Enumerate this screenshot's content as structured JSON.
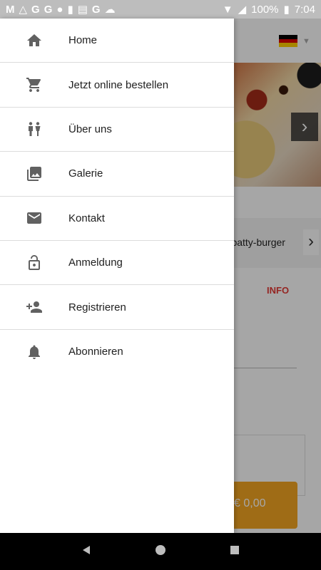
{
  "status_bar": {
    "left_icons": [
      "gmail-icon",
      "triangle-drive-icon",
      "google-icon",
      "google-icon",
      "circle-icon",
      "sd-card-icon",
      "news-icon",
      "google-icon",
      "cloud-icon"
    ],
    "battery_percent": "100%",
    "time": "7:04"
  },
  "drawer": {
    "items": [
      {
        "label": "Home",
        "icon": "home-icon"
      },
      {
        "label": "Jetzt online bestellen",
        "icon": "cart-icon"
      },
      {
        "label": "Über uns",
        "icon": "people-icon"
      },
      {
        "label": "Galerie",
        "icon": "gallery-icon"
      },
      {
        "label": "Kontakt",
        "icon": "mail-icon"
      },
      {
        "label": "Anmeldung",
        "icon": "lock-open-icon"
      },
      {
        "label": "Registrieren",
        "icon": "person-add-icon"
      },
      {
        "label": "Abonnieren",
        "icon": "bell-icon"
      }
    ]
  },
  "background": {
    "category_label": "e-patty-burger",
    "info_tab": "INFO",
    "cart_total": "€ 0,00",
    "flag_colors": [
      "#000000",
      "#dd0000",
      "#ffce00"
    ]
  }
}
